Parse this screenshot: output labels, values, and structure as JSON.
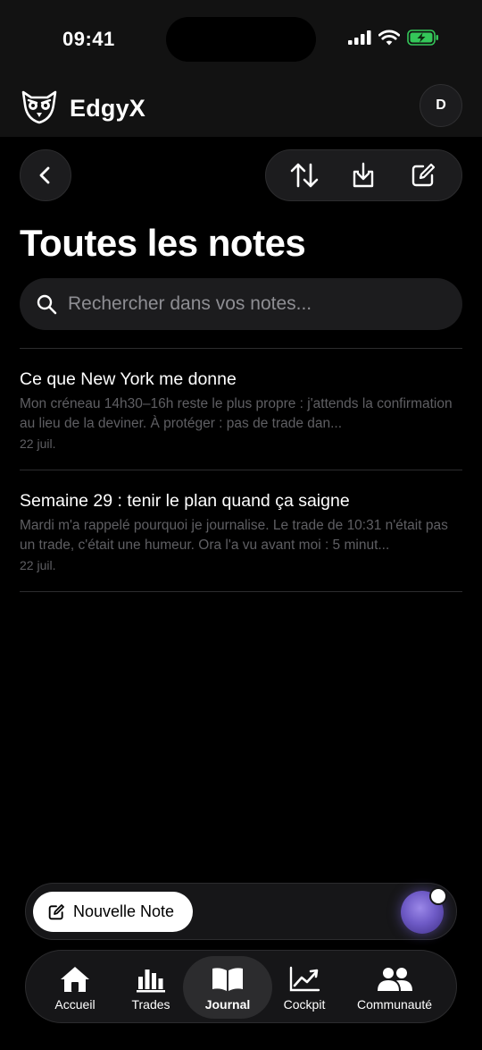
{
  "status_bar": {
    "time": "09:41"
  },
  "header": {
    "brand": "EdgyX",
    "avatar_initial": "D"
  },
  "page": {
    "title": "Toutes les notes"
  },
  "search": {
    "placeholder": "Rechercher dans vos notes..."
  },
  "notes": [
    {
      "title": "Ce que New York me donne",
      "excerpt": "Mon créneau 14h30–16h reste le plus propre : j'attends la confirmation au lieu de la deviner. À protéger : pas de trade dan...",
      "date": "22 juil."
    },
    {
      "title": "Semaine 29 : tenir le plan quand ça saigne",
      "excerpt": "Mardi m'a rappelé pourquoi je journalise. Le trade de 10:31 n'était pas un trade, c'était une humeur. Ora l'a vu avant moi : 5 minut...",
      "date": "22 juil."
    }
  ],
  "actions": {
    "new_note_label": "Nouvelle Note"
  },
  "tabs": [
    {
      "label": "Accueil",
      "icon": "home-icon"
    },
    {
      "label": "Trades",
      "icon": "bar-chart-icon"
    },
    {
      "label": "Journal",
      "icon": "book-icon",
      "active": true
    },
    {
      "label": "Cockpit",
      "icon": "trend-chart-icon"
    },
    {
      "label": "Communauté",
      "icon": "people-icon"
    }
  ],
  "colors": {
    "background": "#000000",
    "surface": "#1c1c1e",
    "muted_text": "#5f5f63",
    "battery_green": "#34c759",
    "orb": "#6f5bc7"
  }
}
